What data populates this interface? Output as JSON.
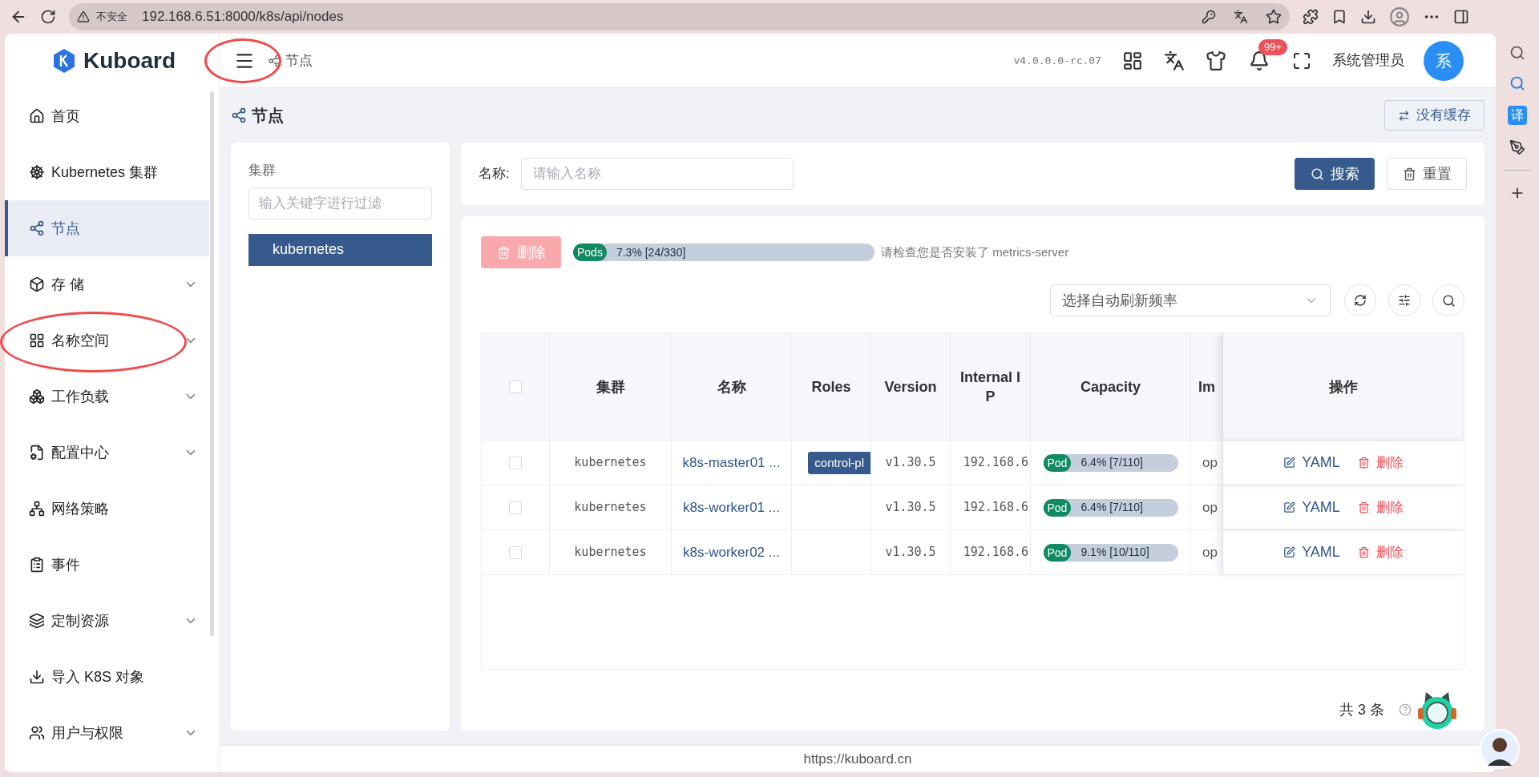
{
  "browser": {
    "security_label": "不安全",
    "url": "192.168.6.51:8000/k8s/api/nodes"
  },
  "browser_sidebar": {
    "translate_badge": "译"
  },
  "header": {
    "logo": "Kuboard",
    "breadcrumb": "节点",
    "version": "v4.0.0.0-rc.07",
    "notification_badge": "99+",
    "user_name": "系统管理员",
    "avatar_initial": "系"
  },
  "sidebar": {
    "items": [
      {
        "label": "首页",
        "selected": false,
        "expandable": false
      },
      {
        "label": "Kubernetes 集群",
        "selected": false,
        "expandable": false
      },
      {
        "label": "节点",
        "selected": true,
        "expandable": false
      },
      {
        "label": "存 储",
        "selected": false,
        "expandable": true
      },
      {
        "label": "名称空间",
        "selected": false,
        "expandable": true
      },
      {
        "label": "工作负载",
        "selected": false,
        "expandable": true
      },
      {
        "label": "配置中心",
        "selected": false,
        "expandable": true
      },
      {
        "label": "网络策略",
        "selected": false,
        "expandable": false
      },
      {
        "label": "事件",
        "selected": false,
        "expandable": false
      },
      {
        "label": "定制资源",
        "selected": false,
        "expandable": true
      },
      {
        "label": "导入 K8S 对象",
        "selected": false,
        "expandable": false
      },
      {
        "label": "用户与权限",
        "selected": false,
        "expandable": true
      }
    ]
  },
  "page": {
    "title": "节点",
    "cache_button": "没有缓存"
  },
  "cluster_panel": {
    "label": "集群",
    "filter_placeholder": "输入关键字进行过滤",
    "clusters": [
      {
        "name": "kubernetes",
        "selected": true
      }
    ]
  },
  "search_bar": {
    "name_label": "名称:",
    "name_placeholder": "请输入名称",
    "search_button": "搜索",
    "reset_button": "重置"
  },
  "toolbar": {
    "delete_button": "删除",
    "delete_disabled": true,
    "pods_usage": {
      "label": "Pods",
      "reading": "7.3% [24/330]",
      "level": 0.073
    },
    "hint": "请检查您是否安装了 metrics-server",
    "refresh_placeholder": "选择自动刷新频率"
  },
  "table": {
    "all_checked": false,
    "columns": [
      "集群",
      "名称",
      "Roles",
      "Version",
      "Internal IP",
      "Capacity",
      "Im",
      "操作"
    ],
    "rows": [
      {
        "checked": false,
        "cluster": "kubernetes",
        "name": "k8s-master01 ...",
        "roles": [
          "control-pl"
        ],
        "version": "v1.30.5",
        "internal_ip": "192.168.6",
        "pods": {
          "label": "Pod",
          "reading": "6.4% [7/110]",
          "level": 0.064
        },
        "column_8": "op",
        "edit_action": "YAML",
        "delete_action": "删除"
      },
      {
        "checked": false,
        "cluster": "kubernetes",
        "name": "k8s-worker01 ...",
        "roles": [],
        "version": "v1.30.5",
        "internal_ip": "192.168.6",
        "pods": {
          "label": "Pod",
          "reading": "6.4% [7/110]",
          "level": 0.064
        },
        "column_8": "op",
        "edit_action": "YAML",
        "delete_action": "删除"
      },
      {
        "checked": false,
        "cluster": "kubernetes",
        "name": "k8s-worker02 ...",
        "roles": [],
        "version": "v1.30.5",
        "internal_ip": "192.168.6",
        "pods": {
          "label": "Pod",
          "reading": "9.1% [10/110]",
          "level": 0.091
        },
        "column_8": "op",
        "edit_action": "YAML",
        "delete_action": "删除"
      }
    ]
  },
  "pagination": {
    "total": "共 3 条"
  },
  "footer": {
    "link": "https://kuboard.cn"
  }
}
